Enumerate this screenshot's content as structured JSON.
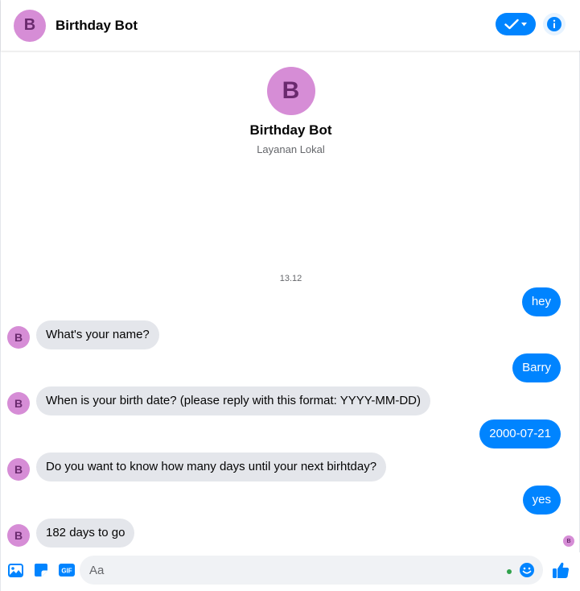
{
  "header": {
    "avatar_letter": "B",
    "title": "Birthday Bot"
  },
  "profile": {
    "avatar_letter": "B",
    "name": "Birthday Bot",
    "subtitle": "Layanan Lokal"
  },
  "timestamp": "13.12",
  "messages": [
    {
      "from": "user",
      "text": "hey"
    },
    {
      "from": "bot",
      "text": "What's your name?"
    },
    {
      "from": "user",
      "text": "Barry"
    },
    {
      "from": "bot",
      "text": "When is your birth date? (please reply with this format: YYYY-MM-DD)"
    },
    {
      "from": "user",
      "text": "2000-07-21"
    },
    {
      "from": "bot",
      "text": "Do you want to know how many days until your next birhtday?"
    },
    {
      "from": "user",
      "text": "yes"
    },
    {
      "from": "bot",
      "text": "182 days to go"
    }
  ],
  "bot_avatar_letter": "B",
  "seen_avatar_letter": "B",
  "composer": {
    "placeholder": "Aa",
    "value": "",
    "tools": [
      "image-icon",
      "sticker-icon",
      "gif-icon"
    ],
    "gif_label": "GIF"
  },
  "colors": {
    "accent": "#0084ff",
    "avatar_bg": "#d68dd6",
    "avatar_fg": "#6a2a6e",
    "incoming_bubble": "#e4e6eb",
    "active_dot": "#31a24c"
  }
}
